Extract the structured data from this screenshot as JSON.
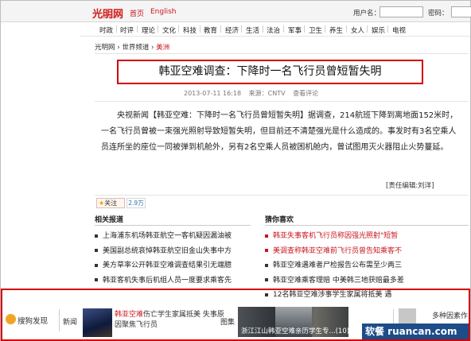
{
  "header": {
    "logo_text": "光明网",
    "logo_sub": "GMW.cn",
    "home": "首页",
    "english": "English",
    "username_label": "用户名：",
    "password_label": "密码："
  },
  "nav": [
    "时政",
    "时评",
    "理论",
    "文化",
    "科技",
    "教育",
    "经济",
    "生活",
    "法治",
    "军事",
    "卫生",
    "养生",
    "女人",
    "娱乐",
    "电视"
  ],
  "breadcrumb": {
    "site": "光明网",
    "sep": "›",
    "channel": "世界频道",
    "region": "美洲"
  },
  "article": {
    "title": "韩亚空难调查：下降时一名飞行员曾短暂失明",
    "date": "2013-07-11 16:18",
    "source": "来源：CNTV",
    "comment": "查看评论",
    "body": "央视新闻【韩亚空难：下降时一名飞行员曾短暂失明】据调查，214航班下降到离地面152米时，一名飞行员曾被一束强光照射导致短暂失明，但目前还不清楚强光是什么造成的。事发时有3名空乘人员连所坐的座位一同被弹到机舱外，另有2名空乘人员被困机舱内，曾试图用灭火器阻止火势蔓延。",
    "editor": "[责任编辑:刘洋]"
  },
  "like": {
    "label": "关注",
    "count": "2.9万"
  },
  "related": {
    "heading": "相关报道",
    "items": [
      "上海浦东机场韩亚航空一客机疑因漏油被",
      "美国副总统哀悼韩亚航空旧金山失事中方",
      "美方草率公开韩亚空难调查结果引无端臆",
      "韩亚客机失事后机组人员一度要求乘客先"
    ]
  },
  "guess": {
    "heading": "猜你喜欢",
    "items": [
      "韩亚失事客机飞行员称因强光照射\"短暂",
      "美调查称韩亚空难前飞行员曾告知乘客不",
      "韩亚空难遇难者尸检报告公布需至少两三",
      "韩亚空难乘客理赔 中美韩三地获赔最多差",
      "12名韩亚空难涉事学生家属将抵美 遇"
    ]
  },
  "bottom": {
    "sougou": "搜狗发现",
    "news_tag": "新闻",
    "news_red": "韩亚空难",
    "news_text": "伤亡学生家属抵美 失事原因聚焦飞行员",
    "pic_tag": "图集",
    "pic_caption": "浙江江山韩亚空难亲历学生专...(10)",
    "right_text": "多种因素作"
  },
  "watermark": "软餐 ruancan.com"
}
